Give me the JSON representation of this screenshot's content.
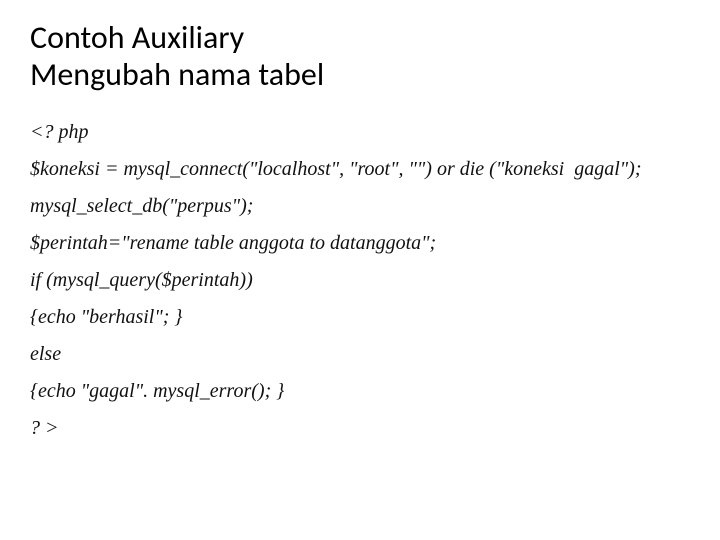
{
  "title": {
    "line1": "Contoh Auxiliary",
    "line2": "Mengubah nama tabel"
  },
  "code": {
    "l1": "<? php",
    "l2": "$koneksi = mysql_connect(\"localhost\", \"root\", \"\") or die (\"koneksi  gagal\");",
    "l3": "mysql_select_db(\"perpus\");",
    "l4": "$perintah=\"rename table anggota to datanggota\";",
    "l5": "if (mysql_query($perintah))",
    "l6": "{echo \"berhasil\"; }",
    "l7": "else",
    "l8": "{echo \"gagal\". mysql_error(); }",
    "l9": "? >"
  }
}
